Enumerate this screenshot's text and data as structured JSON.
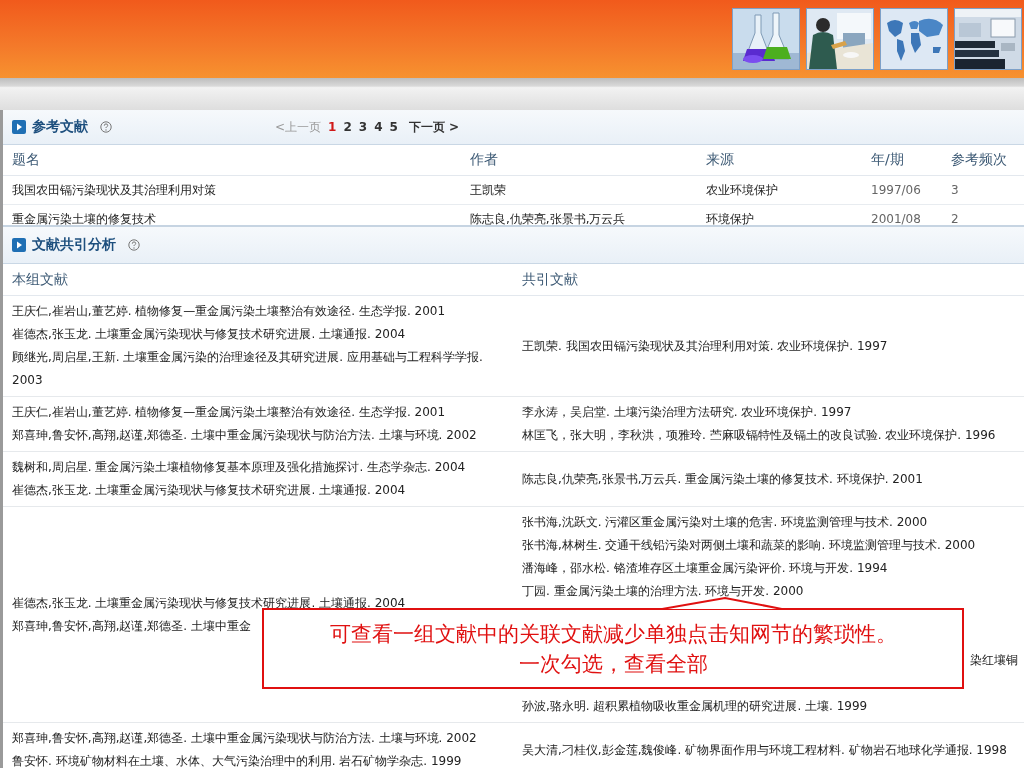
{
  "references": {
    "title": "参考文献",
    "pagination": {
      "prev": {
        "label": "<上一页",
        "disabled": true
      },
      "pages": [
        {
          "label": "1",
          "selected": true
        },
        {
          "label": "2",
          "selected": false
        },
        {
          "label": "3",
          "selected": false
        },
        {
          "label": "4",
          "selected": false
        },
        {
          "label": "5",
          "selected": false
        }
      ],
      "next": {
        "label": "下一页 >",
        "disabled": false
      }
    },
    "columns": [
      "题名",
      "作者",
      "来源",
      "年/期",
      "参考频次"
    ],
    "rows": [
      [
        "我国农田镉污染现状及其治理利用对策",
        "王凯荣",
        "农业环境保护",
        "1997/06",
        "3"
      ],
      [
        "重金属污染土壤的修复技术",
        "陈志良,仇荣亮,张景书,万云兵",
        "环境保护",
        "2001/08",
        "2"
      ]
    ]
  },
  "cocitation": {
    "title": "文献共引分析",
    "columns": [
      "本组文献",
      "共引文献"
    ],
    "rows": [
      {
        "group": [
          "王庆仁,崔岩山,董艺婷. 植物修复—重金属污染土壤整治有效途径. 生态学报. 2001",
          "崔德杰,张玉龙. 土壤重金属污染现状与修复技术研究进展. 土壤通报. 2004",
          "顾继光,周启星,王新. 土壤重金属污染的治理途径及其研究进展. 应用基础与工程科学学报. 2003"
        ],
        "cited": [
          {
            "kind": "line",
            "text": "王凯荣. 我国农田镉污染现状及其治理利用对策. 农业环境保护. 1997"
          }
        ]
      },
      {
        "group": [
          "王庆仁,崔岩山,董艺婷. 植物修复—重金属污染土壤整治有效途径. 生态学报. 2001",
          "郑喜珅,鲁安怀,高翔,赵谨,郑德圣. 土壤中重金属污染现状与防治方法. 土壤与环境. 2002"
        ],
        "cited": [
          {
            "kind": "line",
            "text": "李永涛，吴启堂. 土壤污染治理方法研究. 农业环境保护. 1997"
          },
          {
            "kind": "line",
            "text": "林匡飞，张大明，李秋洪，项雅玲. 苎麻吸镉特性及镉土的改良试验. 农业环境保护. 1996"
          }
        ]
      },
      {
        "group": [
          "魏树和,周启星. 重金属污染土壤植物修复基本原理及强化措施探讨. 生态学杂志. 2004",
          "崔德杰,张玉龙. 土壤重金属污染现状与修复技术研究进展. 土壤通报. 2004"
        ],
        "cited": [
          {
            "kind": "line",
            "text": "陈志良,仇荣亮,张景书,万云兵. 重金属污染土壤的修复技术. 环境保护. 2001"
          }
        ]
      },
      {
        "group": [
          "崔德杰,张玉龙. 土壤重金属污染现状与修复技术研究进展. 土壤通报. 2004",
          "郑喜珅,鲁安怀,高翔,赵谨,郑德圣. 土壤中重金"
        ],
        "cited": [
          {
            "kind": "line",
            "text": "张书海,沈跃文. 污灌区重金属污染对土壤的危害. 环境监测管理与技术. 2000"
          },
          {
            "kind": "line",
            "text": "张书海,林树生. 交通干线铅污染对两侧土壤和蔬菜的影响. 环境监测管理与技术. 2000"
          },
          {
            "kind": "line",
            "text": "潘海峰，邵水松. 铬渣堆存区土壤重金属污染评价. 环境与开发. 1994"
          },
          {
            "kind": "line",
            "text": "丁园. 重金属污染土壤的治理方法. 环境与开发. 2000"
          },
          {
            "kind": "fragment",
            "text": "染红壤铜"
          },
          {
            "kind": "line",
            "text": "孙波,骆永明. 超积累植物吸收重金属机理的研究进展. 土壤. 1999"
          }
        ]
      },
      {
        "group": [
          "郑喜珅,鲁安怀,高翔,赵谨,郑德圣. 土壤中重金属污染现状与防治方法. 土壤与环境. 2002",
          "鲁安怀. 环境矿物材料在土壤、水体、大气污染治理中的利用. 岩石矿物学杂志. 1999"
        ],
        "cited": [
          {
            "kind": "line",
            "text": "吴大清,刁桂仪,彭金莲,魏俊峰. 矿物界面作用与环境工程材料. 矿物岩石地球化学通报. 1998"
          }
        ]
      }
    ]
  },
  "callout": {
    "lines": [
      "可查看一组文献中的关联文献减少单独点击知网节的繁琐性。",
      "一次勾选，查看全部"
    ]
  }
}
